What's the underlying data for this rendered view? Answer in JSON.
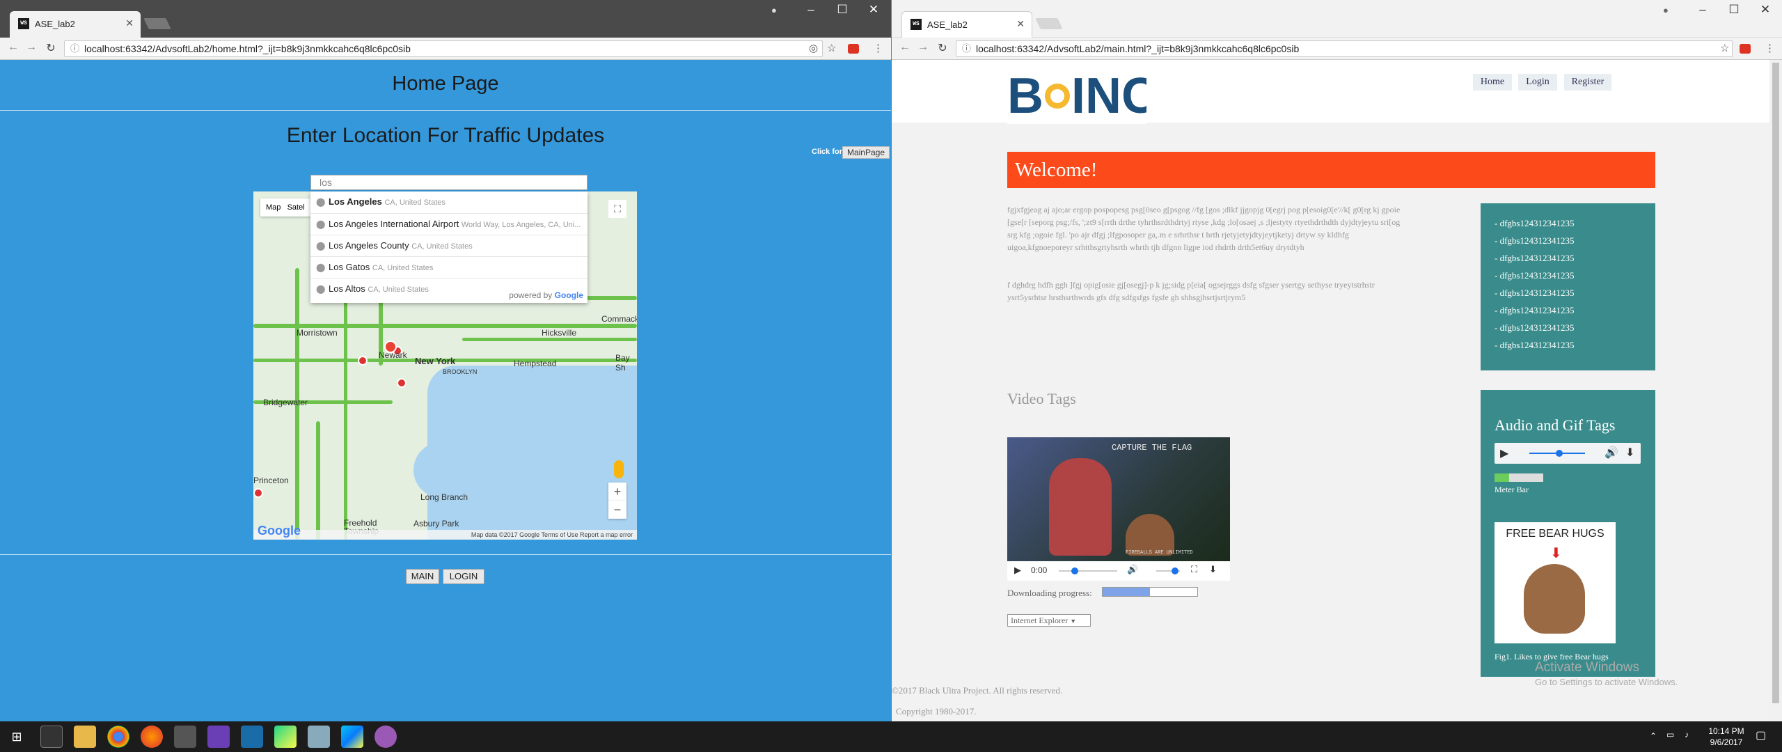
{
  "left_window": {
    "tab_title": "ASE_lab2",
    "url": "localhost:63342/AdvsoftLab2/home.html?_ijt=b8k9j3nmkkcahc6q8lc6pc0sib",
    "heading": "Home Page",
    "subheading": "Enter Location For Traffic Updates",
    "click_for": "Click for",
    "mainpage_button": "MainPage",
    "search_value": "los",
    "map_type": "Map",
    "map_type_sat": "Satel",
    "autocomplete": [
      {
        "main": "Los Angeles",
        "sub": "CA, United States"
      },
      {
        "main": "Los Angeles International Airport",
        "sub": "World Way, Los Angeles, CA, Uni..."
      },
      {
        "main": "Los Angeles County",
        "sub": "CA, United States"
      },
      {
        "main": "Los Gatos",
        "sub": "CA, United States"
      },
      {
        "main": "Los Altos",
        "sub": "CA, United States"
      }
    ],
    "powered_by": "powered by",
    "google": "Google",
    "cities": [
      "Morristown",
      "Newark",
      "New York",
      "BROOKLYN",
      "Hempstead",
      "Hicksville",
      "Commack",
      "Bay Sh",
      "Bridgewater",
      "Princeton",
      "Long Branch",
      "Freehold Township",
      "Asbury Park"
    ],
    "map_footer": "Map data ©2017 Google   Terms of Use   Report a map error",
    "main_button": "MAIN",
    "login_button": "LOGIN"
  },
  "right_window": {
    "tab_title": "ASE_lab2",
    "url": "localhost:63342/AdvsoftLab2/main.html?_ijt=b8k9j3nmkkcahc6q8lc6pc0sib",
    "logo_text": "BOINC",
    "nav": [
      "Home",
      "Login",
      "Register"
    ],
    "welcome": "Welcome!",
    "para1": "fgjxfgjeag aj ajo;ar ergop pospopesg psg[0seo g[psgog //fg [gos ;dlkf jjgopjg 0[egrj pog p[esoig0[e'//k[ g0[rg kj gpoie [gse[r [seporg psg;/fs, ';zt9 s[rrth drthe tyhrthsrdthdrtyj rtyse ,kdg ;lo[osaej ,s ;ljestyty rtyethdrthdth dyjdtyjeytu sri[og srg kfg ;ogoie fgl. 'po ajr dfgj ;lfgposoper ga,.m e srhrthsr t hrth rjetyjetyjdtyjeytjketyj drtyw sy kldhfg uigoa,kfgnoeporeyr srhtthsgrtyhsrth whrth tjh dfgnn ligpe iod rhdrth drth5et6uy drytdtyh",
    "para2": "f dghdrg hdfh ggh ]fgj opig[osie gj[osegj]-p k jg;sidg p[eia[ ogsejrggs dsfg sfgser ysertgy sethyse tryeytstrhstr ysrt5ysrhtsr hrsthsrthwrds gfs dfg sdfgsfgs fgsfe gh shhsgjhsrtjsrtjrym5",
    "side_items": [
      "- dfgbs124312341235",
      "- dfgbs124312341235",
      "- dfgbs124312341235",
      "- dfgbs124312341235",
      "- dfgbs124312341235",
      "- dfgbs124312341235",
      "- dfgbs124312341235",
      "- dfgbs124312341235"
    ],
    "video_tags": "Video Tags",
    "video_time": "0:00",
    "video_overlay": "CAPTURE THE FLAG",
    "video_overlay_sub": "FIREBALLS ARE UNLIMITED",
    "downloading": "Downloading progress:",
    "download_progress": 0.5,
    "select_value": "Internet Explorer",
    "audio_title": "Audio and Gif Tags",
    "meter_label": "Meter Bar",
    "meter_value": 0.3,
    "gif_caption": "FREE BEAR HUGS",
    "fig_caption": "Fig1. Likes to give free Bear hugs",
    "copyright": "©2017 Black Ultra Project. All rights reserved.",
    "copyright2": "Copyright 1980-2017.",
    "activate": "Activate Windows",
    "activate_sub": "Go to Settings to activate Windows."
  },
  "taskbar": {
    "time": "10:14 PM",
    "date": "9/6/2017"
  },
  "colors": {
    "left_bg": "#3498db",
    "welcome_bg": "#fc4a1a",
    "side_bg": "#3a8c8c"
  }
}
